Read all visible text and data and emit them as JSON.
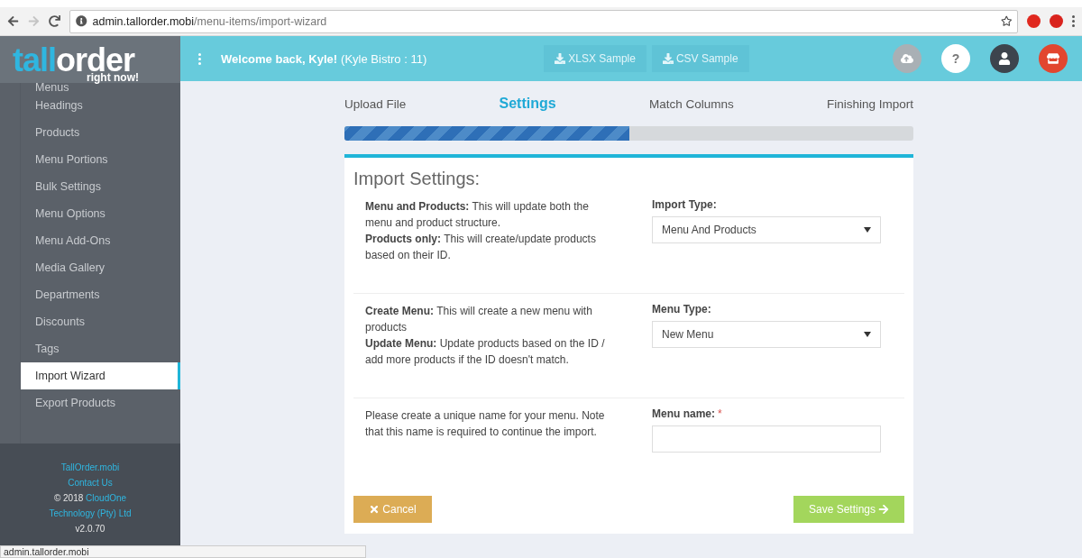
{
  "browser": {
    "url_host": "admin.tallorder.mobi",
    "url_path": "/menu-items/import-wizard",
    "status_url": "admin.tallorder.mobi",
    "forward_disabled": true
  },
  "logo": {
    "name_a": "tall",
    "name_b": "order",
    "tagline": "right now!"
  },
  "sidebar": {
    "items": [
      {
        "label": "Menus",
        "selected": false
      },
      {
        "label": "Headings",
        "selected": false
      },
      {
        "label": "Products",
        "selected": false
      },
      {
        "label": "Menu Portions",
        "selected": false
      },
      {
        "label": "Bulk Settings",
        "selected": false
      },
      {
        "label": "Menu Options",
        "selected": false
      },
      {
        "label": "Menu Add-Ons",
        "selected": false
      },
      {
        "label": "Media Gallery",
        "selected": false
      },
      {
        "label": "Departments",
        "selected": false
      },
      {
        "label": "Discounts",
        "selected": false
      },
      {
        "label": "Tags",
        "selected": false
      },
      {
        "label": "Import Wizard",
        "selected": true
      },
      {
        "label": "Export Products",
        "selected": false
      }
    ],
    "footer": {
      "site": "TallOrder.mobi",
      "contact": "Contact Us",
      "copyright": "© 2018",
      "company_a": "CloudOne",
      "company_b": "Technology (Pty) Ltd",
      "version": "v2.0.70"
    }
  },
  "header": {
    "welcome": "Welcome back, Kyle!",
    "venue": "(Kyle Bistro : 11)",
    "samples": [
      "XLSX Sample",
      "CSV Sample"
    ],
    "help": "?"
  },
  "steps": [
    {
      "label": "Upload File",
      "selected": false
    },
    {
      "label": "Settings",
      "selected": true
    },
    {
      "label": "Match Columns",
      "selected": false
    },
    {
      "label": "Finishing Import",
      "selected": false
    }
  ],
  "progress": {
    "level": 0.5
  },
  "card": {
    "title": "Import Settings:",
    "rows": [
      {
        "kind": "select",
        "lines": [
          "**Menu and Products:** This will update both the menu and product structure.",
          "**Products only:** This will create/update products based on their ID."
        ],
        "label": "Import Type:",
        "value": "Menu And Products"
      },
      {
        "kind": "select",
        "lines": [
          "**Create Menu:** This will create a new menu with products",
          "**Update Menu:** Update products based on the ID / add more products if the ID doesn't match."
        ],
        "label": "Menu Type:",
        "value": "New Menu"
      },
      {
        "kind": "text",
        "lines": [
          "Please create a unique name for your menu. Note that this name is required to continue the import."
        ],
        "label": "Menu name:",
        "value": "",
        "required_mark": "*"
      }
    ],
    "cancel": "Cancel",
    "save": "Save Settings"
  }
}
